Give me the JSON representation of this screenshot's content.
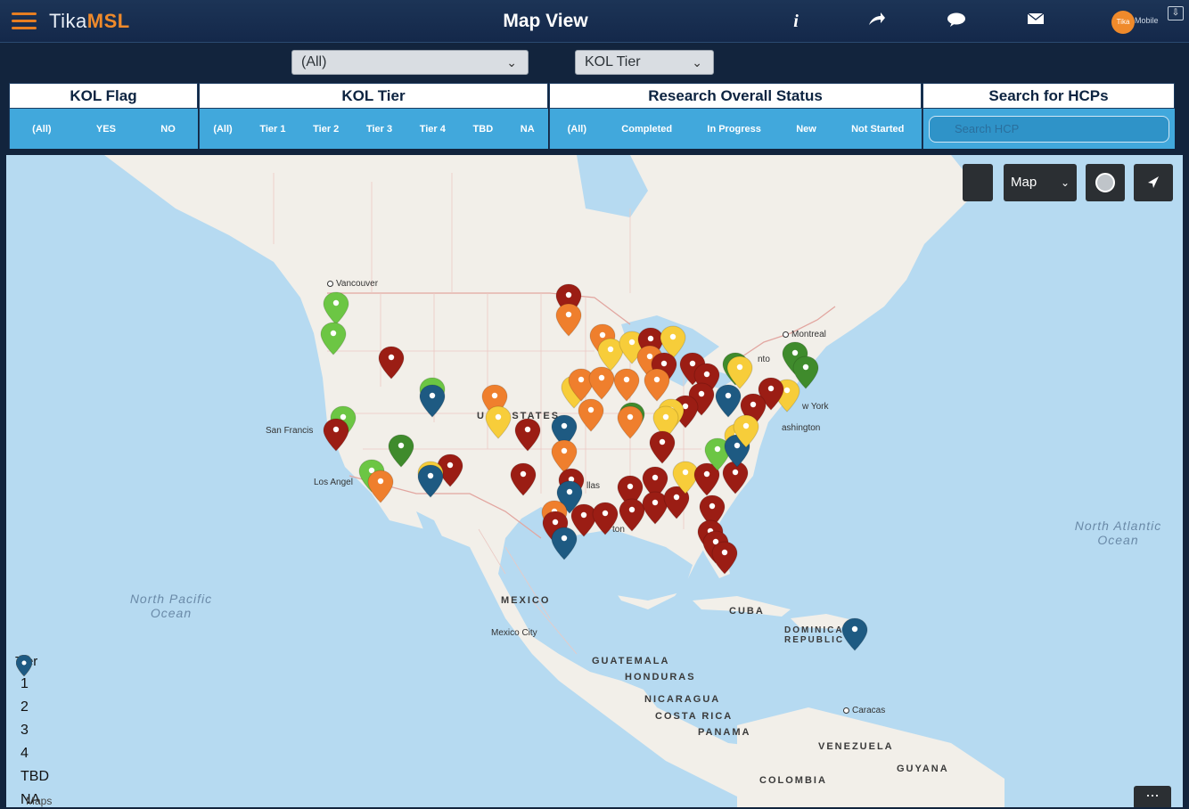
{
  "app": {
    "brand_prefix": "Tika",
    "brand_suffix": "MSL",
    "title": "Map View",
    "user_initial": "Tika",
    "user_label": "Mobile"
  },
  "toolbar": {
    "info_icon": "info-icon",
    "share_icon": "share-icon",
    "chat_icon": "chat-icon",
    "mail_icon": "mail-icon"
  },
  "dropdowns": {
    "primary": "(All)",
    "secondary": "KOL Tier"
  },
  "filters": {
    "kol_flag": {
      "label": "KOL Flag",
      "options": [
        "(All)",
        "YES",
        "NO"
      ]
    },
    "kol_tier": {
      "label": "KOL Tier",
      "options": [
        "(All)",
        "Tier 1",
        "Tier 2",
        "Tier 3",
        "Tier 4",
        "TBD",
        "NA"
      ]
    },
    "research": {
      "label": "Research Overall Status",
      "options": [
        "(All)",
        "Completed",
        "In Progress",
        "New",
        "Not Started"
      ]
    },
    "search": {
      "label": "Search for HCPs",
      "placeholder": "Search HCP"
    }
  },
  "map": {
    "type_select": "Map",
    "labels": {
      "vancouver": "Vancouver",
      "montreal": "Montreal",
      "toronto": "nto",
      "new_york": "w York",
      "washington": "ashington",
      "san_francisco": "San Francis",
      "los_angeles": "Los Angel",
      "dallas": "llas",
      "houston": "ton",
      "united_states": "U      ED STATES",
      "mexico": "MEXICO",
      "mexico_city": "Mexico City",
      "cuba": "CUBA",
      "dominican_republic": "DOMINICAN REPUBLIC",
      "guatemala": "GUATEMALA",
      "honduras": "HONDURAS",
      "nicaragua": "NICARAGUA",
      "costa_rica": "COSTA RICA",
      "panama": "PANAMA",
      "caracas": "Caracas",
      "venezuela": "VENEZUELA",
      "guyana": "GUYANA",
      "colombia": "COLOMBIA",
      "north_pacific": "North Pacific Ocean",
      "north_atlantic": "North Atlantic Ocean",
      "maps_credit": "Maps"
    }
  },
  "legend": {
    "title": "Tier",
    "items": [
      {
        "label": "1",
        "color": "#3f8b2c"
      },
      {
        "label": "2",
        "color": "#6cc644"
      },
      {
        "label": "3",
        "color": "#f7cd3a"
      },
      {
        "label": "4",
        "color": "#ef7f2d"
      },
      {
        "label": "TBD",
        "color": "#9b1d14"
      },
      {
        "label": "NA",
        "color": "#1e5a82"
      }
    ]
  },
  "colors": {
    "tier1": "#3f8b2c",
    "tier2": "#6cc644",
    "tier3": "#f7cd3a",
    "tier4": "#ef7f2d",
    "tbd": "#9b1d14",
    "na": "#1e5a82",
    "accent": "#ef8a2b",
    "filter_bar": "#41a8dc"
  }
}
